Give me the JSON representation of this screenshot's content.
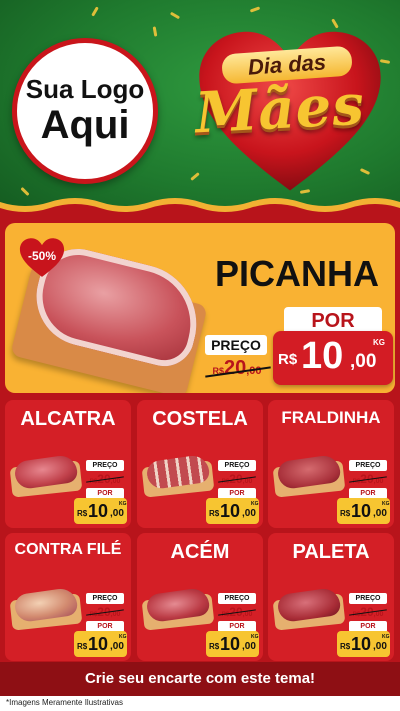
{
  "header": {
    "logo_line1": "Sua Logo",
    "logo_line2": "Aqui",
    "title_small": "Dia das",
    "title_big": "Mães"
  },
  "hero": {
    "name": "PICANHA",
    "discount": "-50%",
    "preco_label": "PREÇO",
    "old_currency": "R$",
    "old_int": "20",
    "old_dec": ",00",
    "por_label": "POR",
    "new_currency": "R$",
    "new_int": "10",
    "new_dec": ",00",
    "unit": "KG"
  },
  "products": [
    {
      "name": "ALCATRA",
      "preco_label": "PREÇO",
      "old_currency": "R$",
      "old_int": "20",
      "old_dec": ",00",
      "por_label": "POR",
      "new_currency": "R$",
      "new_int": "10",
      "new_dec": ",00",
      "unit": "KG"
    },
    {
      "name": "COSTELA",
      "preco_label": "PREÇO",
      "old_currency": "R$",
      "old_int": "20",
      "old_dec": ",00",
      "por_label": "POR",
      "new_currency": "R$",
      "new_int": "10",
      "new_dec": ",00",
      "unit": "KG"
    },
    {
      "name": "FRALDINHA",
      "preco_label": "PREÇO",
      "old_currency": "R$",
      "old_int": "20",
      "old_dec": ",00",
      "por_label": "POR",
      "new_currency": "R$",
      "new_int": "10",
      "new_dec": ",00",
      "unit": "KG"
    },
    {
      "name": "CONTRA FILÉ",
      "preco_label": "PREÇO",
      "old_currency": "R$",
      "old_int": "20",
      "old_dec": ",00",
      "por_label": "POR",
      "new_currency": "R$",
      "new_int": "10",
      "new_dec": ",00",
      "unit": "KG"
    },
    {
      "name": "ACÉM",
      "preco_label": "PREÇO",
      "old_currency": "R$",
      "old_int": "20",
      "old_dec": ",00",
      "por_label": "POR",
      "new_currency": "R$",
      "new_int": "10",
      "new_dec": ",00",
      "unit": "KG"
    },
    {
      "name": "PALETA",
      "preco_label": "PREÇO",
      "old_currency": "R$",
      "old_int": "20",
      "old_dec": ",00",
      "por_label": "POR",
      "new_currency": "R$",
      "new_int": "10",
      "new_dec": ",00",
      "unit": "KG"
    }
  ],
  "footer": {
    "cta": "Crie seu encarte com este tema!",
    "disclaimer": "*Imagens Meramente Ilustrativas"
  },
  "colors": {
    "background_green": "#1f7a2e",
    "main_red": "#b8141b",
    "card_red": "#d41f26",
    "hero_yellow": "#f9b233",
    "price_yellow": "#f7c531",
    "cta_dark_red": "#8e0f14"
  }
}
